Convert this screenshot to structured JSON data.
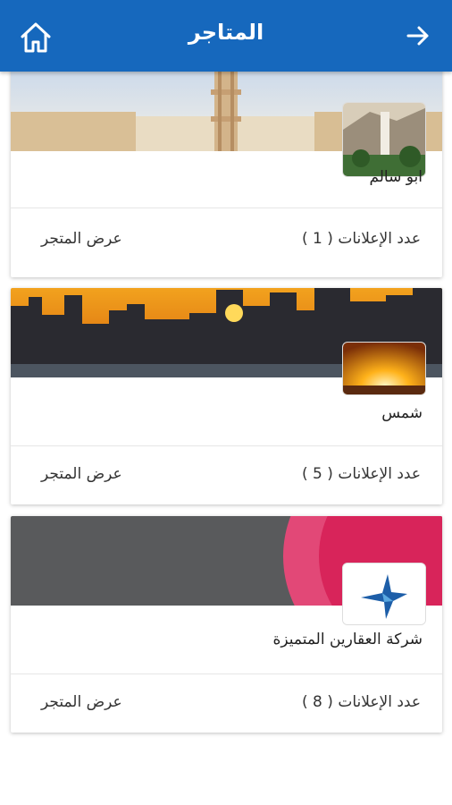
{
  "header": {
    "title": "المتاجر",
    "home_icon": "home-icon",
    "back_icon": "arrow-right-icon",
    "color": "#1668bd"
  },
  "stores": [
    {
      "name": "ابو سالم",
      "count_label": "عدد الإعلانات",
      "count": "( 1 )",
      "view_label": "عرض المتجر"
    },
    {
      "name": "شمس",
      "count_label": "عدد الإعلانات",
      "count": "( 5 )",
      "view_label": "عرض المتجر"
    },
    {
      "name": "شركة العقارين المتميزة",
      "count_label": "عدد الإعلانات",
      "count": "( 8 )",
      "view_label": "عرض المتجر"
    }
  ]
}
